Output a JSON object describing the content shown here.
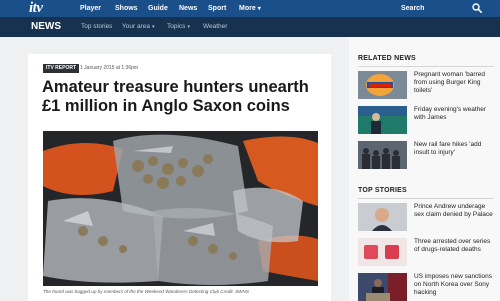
{
  "header": {
    "logo": "itv",
    "nav": [
      "Player",
      "Shows",
      "Guide",
      "News",
      "Sport",
      "More"
    ],
    "search_placeholder": "Search"
  },
  "subheader": {
    "section": "NEWS",
    "links": [
      "Top stories",
      "Your area",
      "Topics",
      "Weather"
    ]
  },
  "article": {
    "badge": "ITV REPORT",
    "date": "1 January 2015 at 1:36pm",
    "headline": "Amateur treasure hunters unearth £1 million in Anglo Saxon coins",
    "caption": "The hoard was bagged up by members of the the Weekend Wanderers Detecting Club Credit: SWNS"
  },
  "related_news": {
    "heading": "RELATED NEWS",
    "items": [
      {
        "text": "Pregnant woman 'barred from using Burger King toilets'",
        "thumb_icon": "burger-king-logo"
      },
      {
        "text": "Friday evening's weather with James",
        "thumb_icon": "weather-presenter"
      },
      {
        "text": "New rail fare hikes 'add insult to injury'",
        "thumb_icon": "commuters"
      }
    ]
  },
  "top_stories": {
    "heading": "TOP STORIES",
    "items": [
      {
        "text": "Prince Andrew underage sex claim denied by Palace",
        "thumb_icon": "prince-andrew"
      },
      {
        "text": "Three arrested over series of drugs-related deaths",
        "thumb_icon": "pink-pills"
      },
      {
        "text": "US imposes new sanctions on North Korea over Sony hacking",
        "thumb_icon": "press-conference"
      }
    ]
  },
  "colors": {
    "header_blue": "#1b4f8a",
    "subheader_navy": "#17324f",
    "page_bg": "#eef0f2"
  }
}
